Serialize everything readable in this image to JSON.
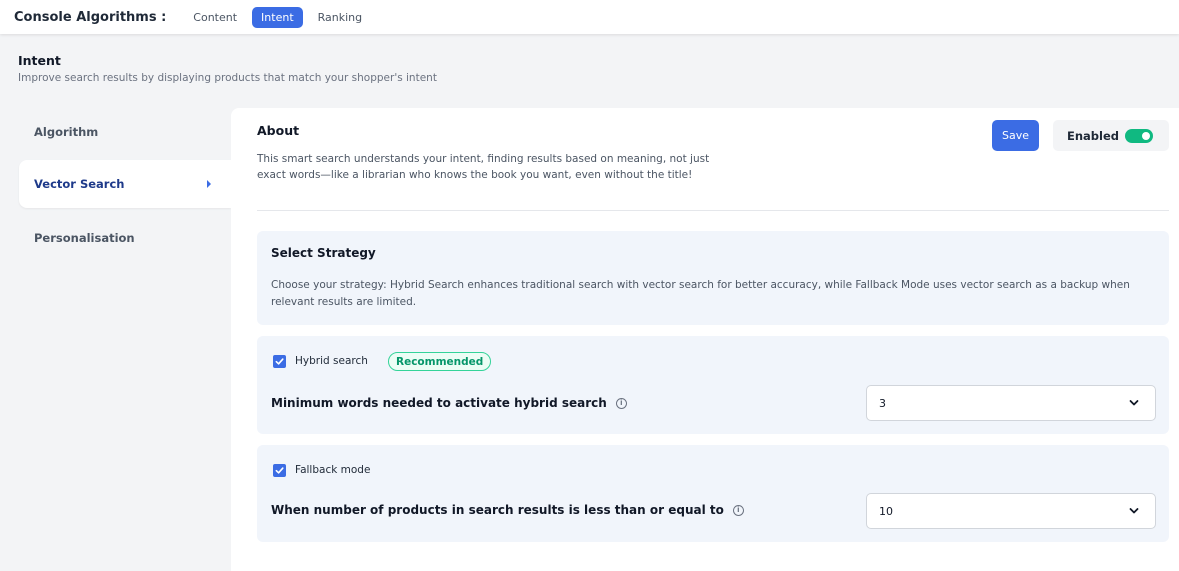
{
  "header": {
    "title": "Console Algorithms :",
    "tabs": [
      {
        "label": "Content"
      },
      {
        "label": "Intent"
      },
      {
        "label": "Ranking"
      }
    ]
  },
  "page": {
    "title": "Intent",
    "subtitle": "Improve search results by displaying products that match your shopper's intent"
  },
  "sidebar": {
    "items": [
      {
        "label": "Algorithm"
      },
      {
        "label": "Vector Search"
      },
      {
        "label": "Personalisation"
      }
    ],
    "active_icon": "caret-right-icon"
  },
  "about": {
    "title": "About",
    "text": "This smart search understands your intent, finding results based on meaning, not just exact words—like a librarian who knows the book you want, even without the title!",
    "save_label": "Save",
    "enabled_label": "Enabled",
    "enabled": true
  },
  "strategy": {
    "title": "Select Strategy",
    "text": "Choose your strategy: Hybrid Search enhances traditional search with vector search for better accuracy, while Fallback Mode uses vector search as a backup when relevant results are limited."
  },
  "hybrid": {
    "label": "Hybrid search",
    "checked": true,
    "badge": "Recommended",
    "field_label": "Minimum words needed to activate hybrid search",
    "value": "3"
  },
  "fallback": {
    "label": "Fallback mode",
    "checked": true,
    "field_label": "When number of products in search results is less than or equal to",
    "value": "10"
  },
  "colors": {
    "accent": "#3b6ce4",
    "toggle_on": "#10b981",
    "badge": "#059669"
  }
}
